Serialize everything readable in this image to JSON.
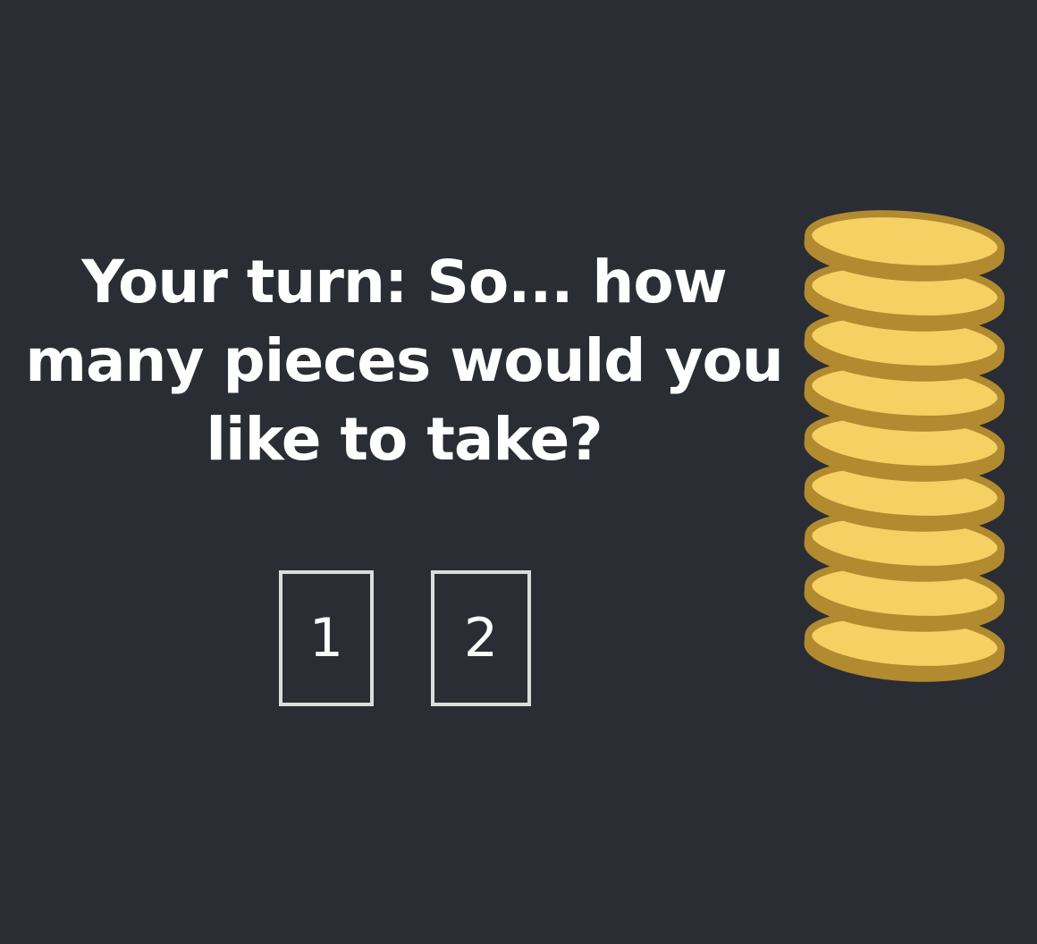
{
  "game": {
    "prompt": "Your turn: So... how many pieces would you like to take?",
    "choices": [
      {
        "label": "1"
      },
      {
        "label": "2"
      }
    ],
    "pile": {
      "count": 9,
      "piece": "gold-coin-icon",
      "colors": {
        "coin_face": "#f5d063",
        "coin_rim": "#b28a2f"
      }
    }
  },
  "colors": {
    "background": "#2a2d34",
    "text": "#ffffff",
    "button_border": "#dcdcdc"
  }
}
